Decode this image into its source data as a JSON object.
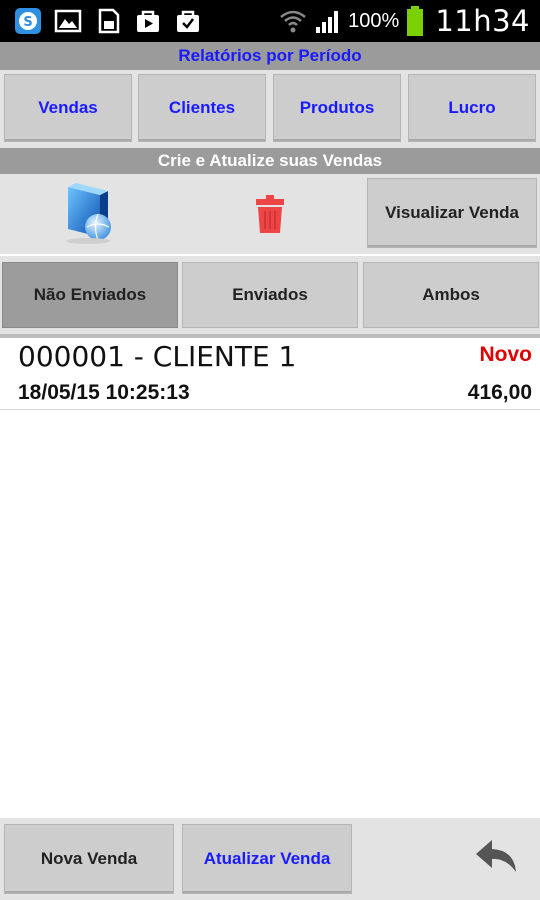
{
  "status_bar": {
    "battery_percent": "100%",
    "time": "11h34",
    "icons": [
      "skype-icon",
      "gallery-icon",
      "sd-card-icon",
      "store-icon",
      "store-check-icon",
      "wifi-icon",
      "signal-icon",
      "battery-icon"
    ]
  },
  "reports": {
    "header": "Relatórios por Período",
    "buttons": [
      "Vendas",
      "Clientes",
      "Produtos",
      "Lucro"
    ]
  },
  "sales": {
    "header": "Crie e Atualize suas Vendas",
    "view_button": "Visualizar Venda"
  },
  "tabs": {
    "items": [
      "Não Enviados",
      "Enviados",
      "Ambos"
    ],
    "active": "Não Enviados"
  },
  "list": [
    {
      "title": "000001 - CLIENTE 1",
      "status": "Novo",
      "datetime": "18/05/15 10:25:13",
      "total": "416,00"
    }
  ],
  "bottom": {
    "new_sale": "Nova Venda",
    "update_sale": "Atualizar Venda"
  },
  "colors": {
    "accent_blue": "#1a1aff",
    "status_red": "#e00000",
    "header_gray": "#9b9b9b"
  }
}
